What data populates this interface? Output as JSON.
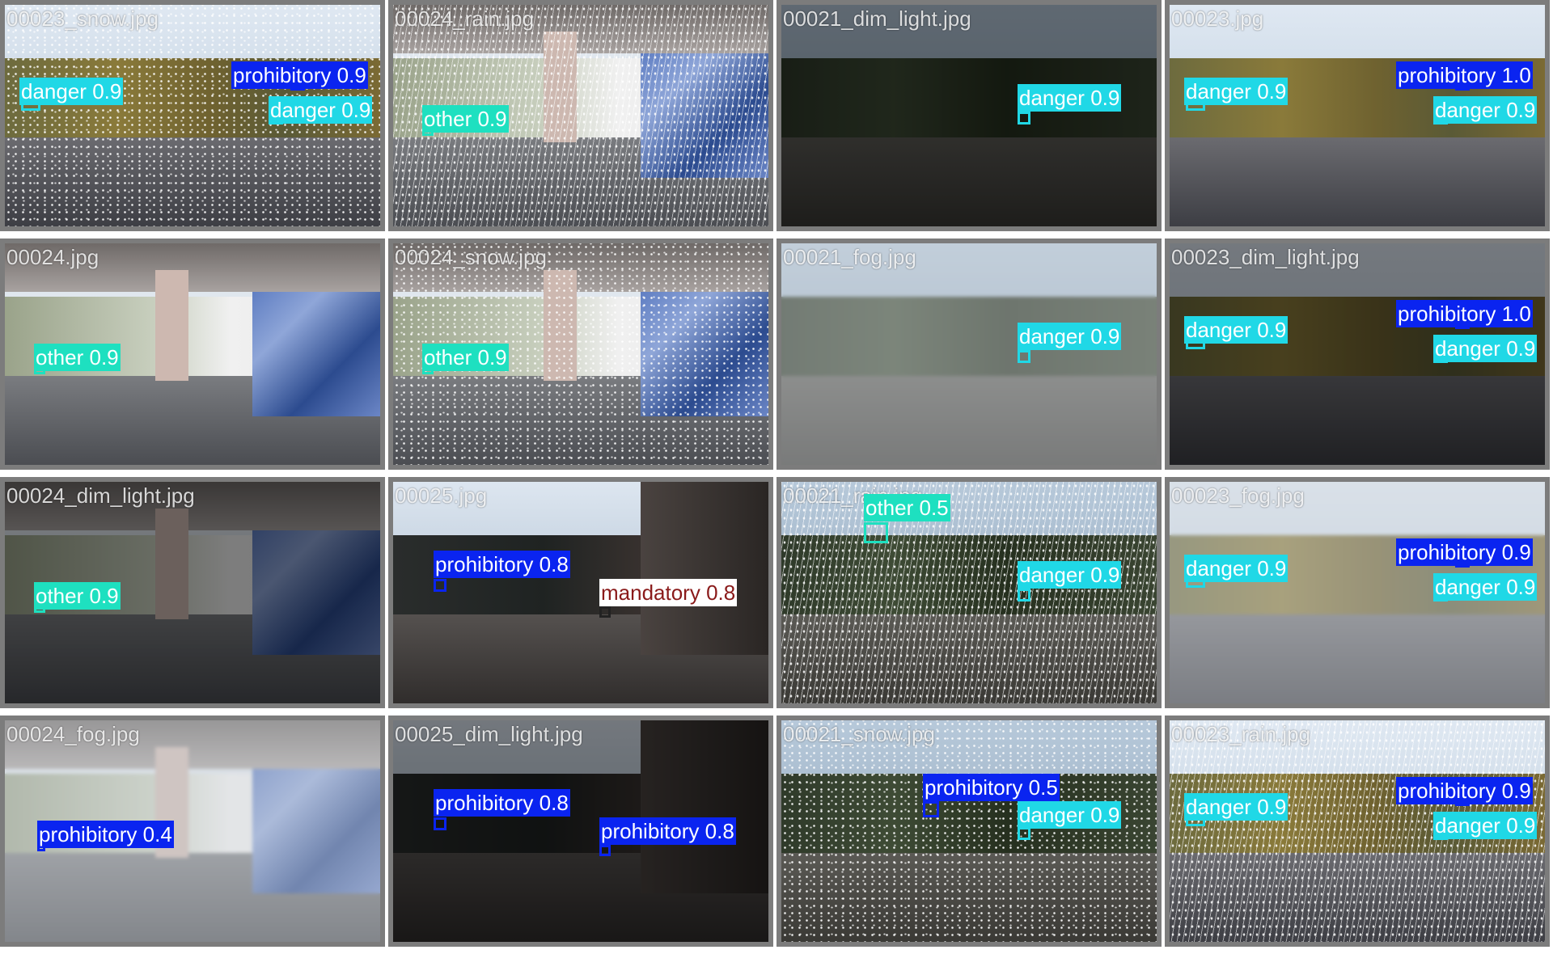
{
  "colors": {
    "danger": "#20d8e6",
    "prohibitory": "#0a24f0",
    "other": "#1ee0c0",
    "mandatory": "#ffffff",
    "mandatory_text": "#8a1a1a"
  },
  "tiles": [
    {
      "file": "00023_snow.jpg",
      "scene": "street",
      "effect": "snow",
      "detections": [
        {
          "cls": "danger",
          "conf": "0.9"
        },
        {
          "cls": "prohibitory",
          "conf": "0.9"
        },
        {
          "cls": "danger",
          "conf": "0.9"
        }
      ]
    },
    {
      "file": "00024_rain.jpg",
      "scene": "underpass",
      "effect": "rain",
      "detections": [
        {
          "cls": "other",
          "conf": "0.9"
        }
      ]
    },
    {
      "file": "00021_dim_light.jpg",
      "scene": "forest",
      "effect": "dim",
      "detections": [
        {
          "cls": "danger",
          "conf": "0.9"
        }
      ]
    },
    {
      "file": "00023.jpg",
      "scene": "street",
      "effect": "none",
      "detections": [
        {
          "cls": "danger",
          "conf": "0.9"
        },
        {
          "cls": "prohibitory",
          "conf": "1.0"
        },
        {
          "cls": "danger",
          "conf": "0.9"
        }
      ]
    },
    {
      "file": "00024.jpg",
      "scene": "underpass",
      "effect": "none",
      "detections": [
        {
          "cls": "other",
          "conf": "0.9"
        }
      ]
    },
    {
      "file": "00024_snow.jpg",
      "scene": "underpass",
      "effect": "snow",
      "detections": [
        {
          "cls": "other",
          "conf": "0.9"
        }
      ]
    },
    {
      "file": "00021_fog.jpg",
      "scene": "forest",
      "effect": "fog",
      "detections": [
        {
          "cls": "danger",
          "conf": "0.9"
        }
      ]
    },
    {
      "file": "00023_dim_light.jpg",
      "scene": "street",
      "effect": "dim",
      "detections": [
        {
          "cls": "danger",
          "conf": "0.9"
        },
        {
          "cls": "prohibitory",
          "conf": "1.0"
        },
        {
          "cls": "danger",
          "conf": "0.9"
        }
      ]
    },
    {
      "file": "00024_dim_light.jpg",
      "scene": "underpass",
      "effect": "dim",
      "detections": [
        {
          "cls": "other",
          "conf": "0.9"
        }
      ]
    },
    {
      "file": "00025.jpg",
      "scene": "town",
      "effect": "none",
      "detections": [
        {
          "cls": "prohibitory",
          "conf": "0.8"
        },
        {
          "cls": "mandatory",
          "conf": "0.8"
        }
      ]
    },
    {
      "file": "00021_rain.jpg",
      "scene": "forest",
      "effect": "rain",
      "detections": [
        {
          "cls": "other",
          "conf": "0.5"
        },
        {
          "cls": "danger",
          "conf": "0.9"
        }
      ]
    },
    {
      "file": "00023_fog.jpg",
      "scene": "street",
      "effect": "fog",
      "detections": [
        {
          "cls": "danger",
          "conf": "0.9"
        },
        {
          "cls": "prohibitory",
          "conf": "0.9"
        },
        {
          "cls": "danger",
          "conf": "0.9"
        }
      ]
    },
    {
      "file": "00024_fog.jpg",
      "scene": "underpass",
      "effect": "fog",
      "detections": [
        {
          "cls": "prohibitory",
          "conf": "0.4"
        }
      ]
    },
    {
      "file": "00025_dim_light.jpg",
      "scene": "town",
      "effect": "dim",
      "detections": [
        {
          "cls": "prohibitory",
          "conf": "0.8"
        },
        {
          "cls": "prohibitory",
          "conf": "0.8"
        }
      ]
    },
    {
      "file": "00021_snow.jpg",
      "scene": "forest",
      "effect": "snow",
      "detections": [
        {
          "cls": "prohibitory",
          "conf": "0.5"
        },
        {
          "cls": "danger",
          "conf": "0.9"
        }
      ]
    },
    {
      "file": "00023_rain.jpg",
      "scene": "street",
      "effect": "rain",
      "detections": [
        {
          "cls": "danger",
          "conf": "0.9"
        },
        {
          "cls": "prohibitory",
          "conf": "0.9"
        },
        {
          "cls": "danger",
          "conf": "0.9"
        }
      ]
    }
  ]
}
